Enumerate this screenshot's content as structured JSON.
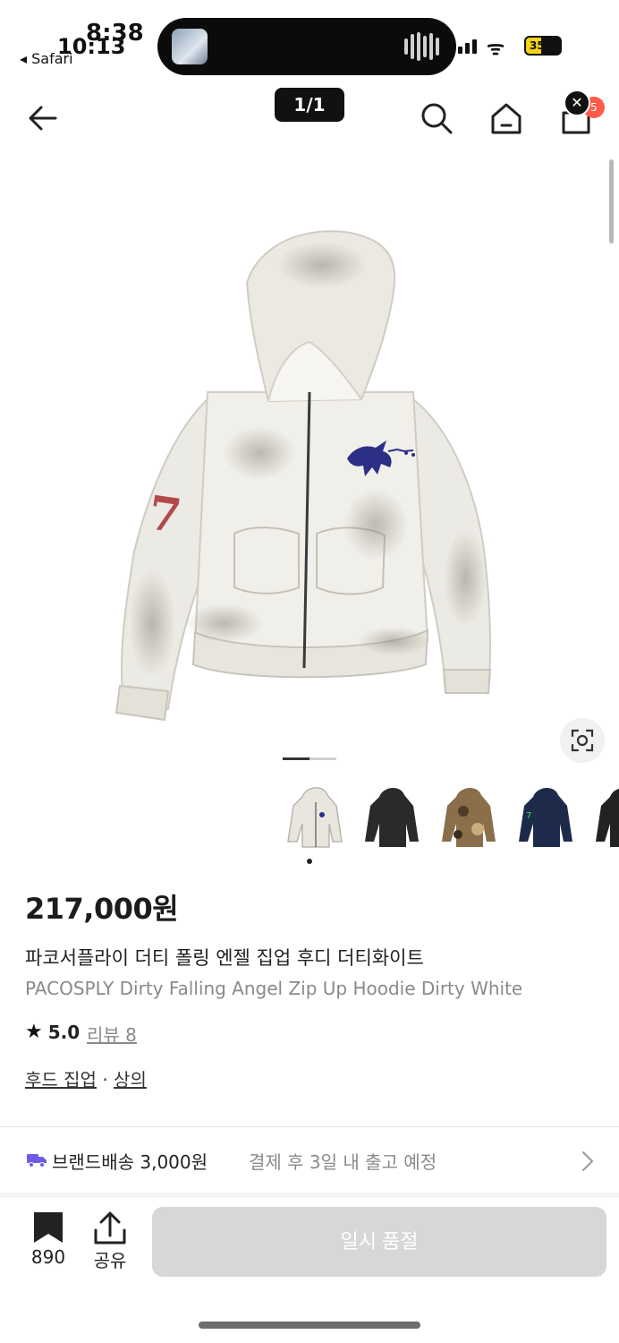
{
  "status_bar": {
    "time_primary": "8:38",
    "time_behind": "10:13",
    "back_app": "◂ Safari",
    "battery": "35"
  },
  "nav": {
    "page_indicator": "1/1",
    "cart_count": "5",
    "close_symbol": "✕"
  },
  "product": {
    "price": "217,000원",
    "name_ko": "파코서플라이 더티 폴링 엔젤 집업 후디 더티화이트",
    "name_en": "PACOSPLY Dirty Falling Angel Zip Up Hoodie Dirty White",
    "rating": "5.0",
    "reviews": "리뷰 8",
    "category_1": "후드 집업",
    "category_sep": " · ",
    "category_2": "상의",
    "thumbnail_colors": [
      "#e9e6e0",
      "#2a2a2a",
      "#8b6e4a",
      "#1e2a4a",
      "#222222"
    ]
  },
  "shipping": {
    "main": "브랜드배송 3,000원",
    "sub": "결제 후 3일 내 출고 예정"
  },
  "bottom_bar": {
    "bookmark_count": "890",
    "share_label": "공유",
    "buy_label": "일시 품절"
  },
  "colors": {
    "accent_truck": "#6c5ce7",
    "badge": "#ff5a4a",
    "disabled_button": "#d7d7d7"
  }
}
